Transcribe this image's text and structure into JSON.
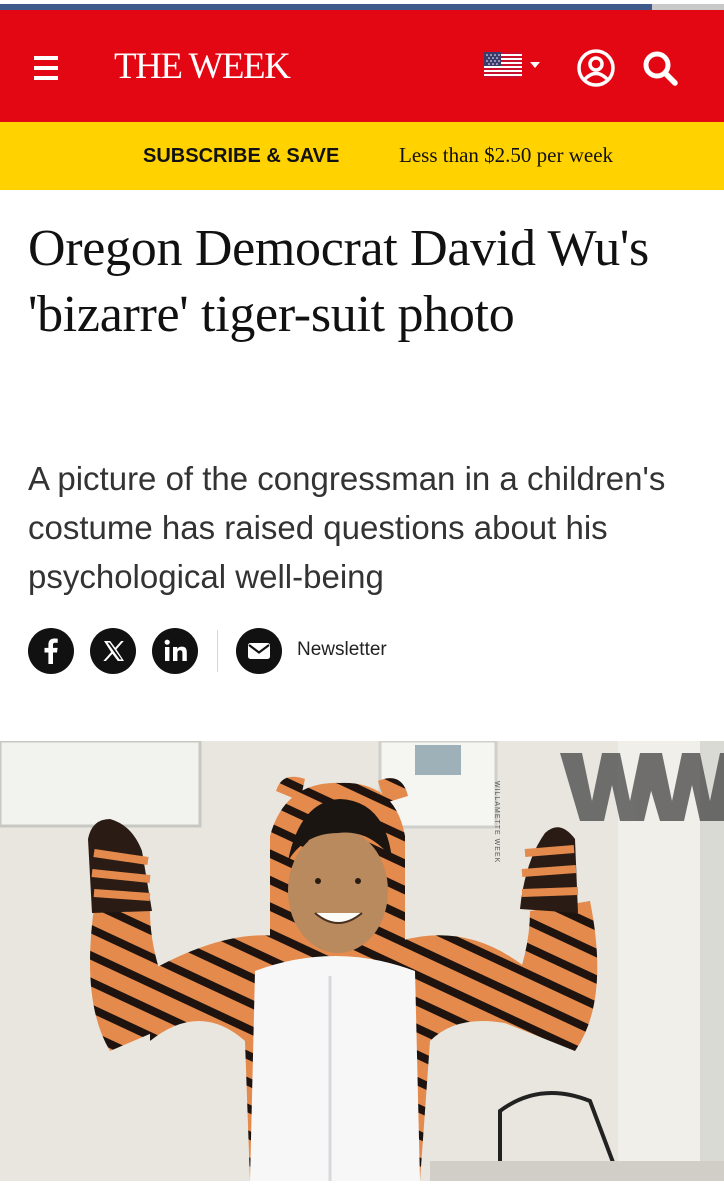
{
  "header": {
    "brand": "THE WEEK",
    "menu_icon": "hamburger-menu-icon",
    "region_icon": "us-flag-icon",
    "account_icon": "user-icon",
    "search_icon": "search-icon",
    "background_color": "#e30613"
  },
  "promo": {
    "cta": "SUBSCRIBE & SAVE",
    "text": "Less than $2.50 per week",
    "background_color": "#ffd200"
  },
  "article": {
    "headline": "Oregon Democrat David Wu's 'bizarre' tiger-suit photo",
    "standfirst": "A picture of the congressman in a children's costume has raised questions about his psychological well-being"
  },
  "share": {
    "buttons": [
      "facebook-icon",
      "x-icon",
      "linkedin-icon"
    ],
    "newsletter_icon": "mail-icon",
    "newsletter_label": "Newsletter"
  },
  "hero_image": {
    "watermark": "WW",
    "watermark_caption": "WILLAMETTE WEEK"
  }
}
